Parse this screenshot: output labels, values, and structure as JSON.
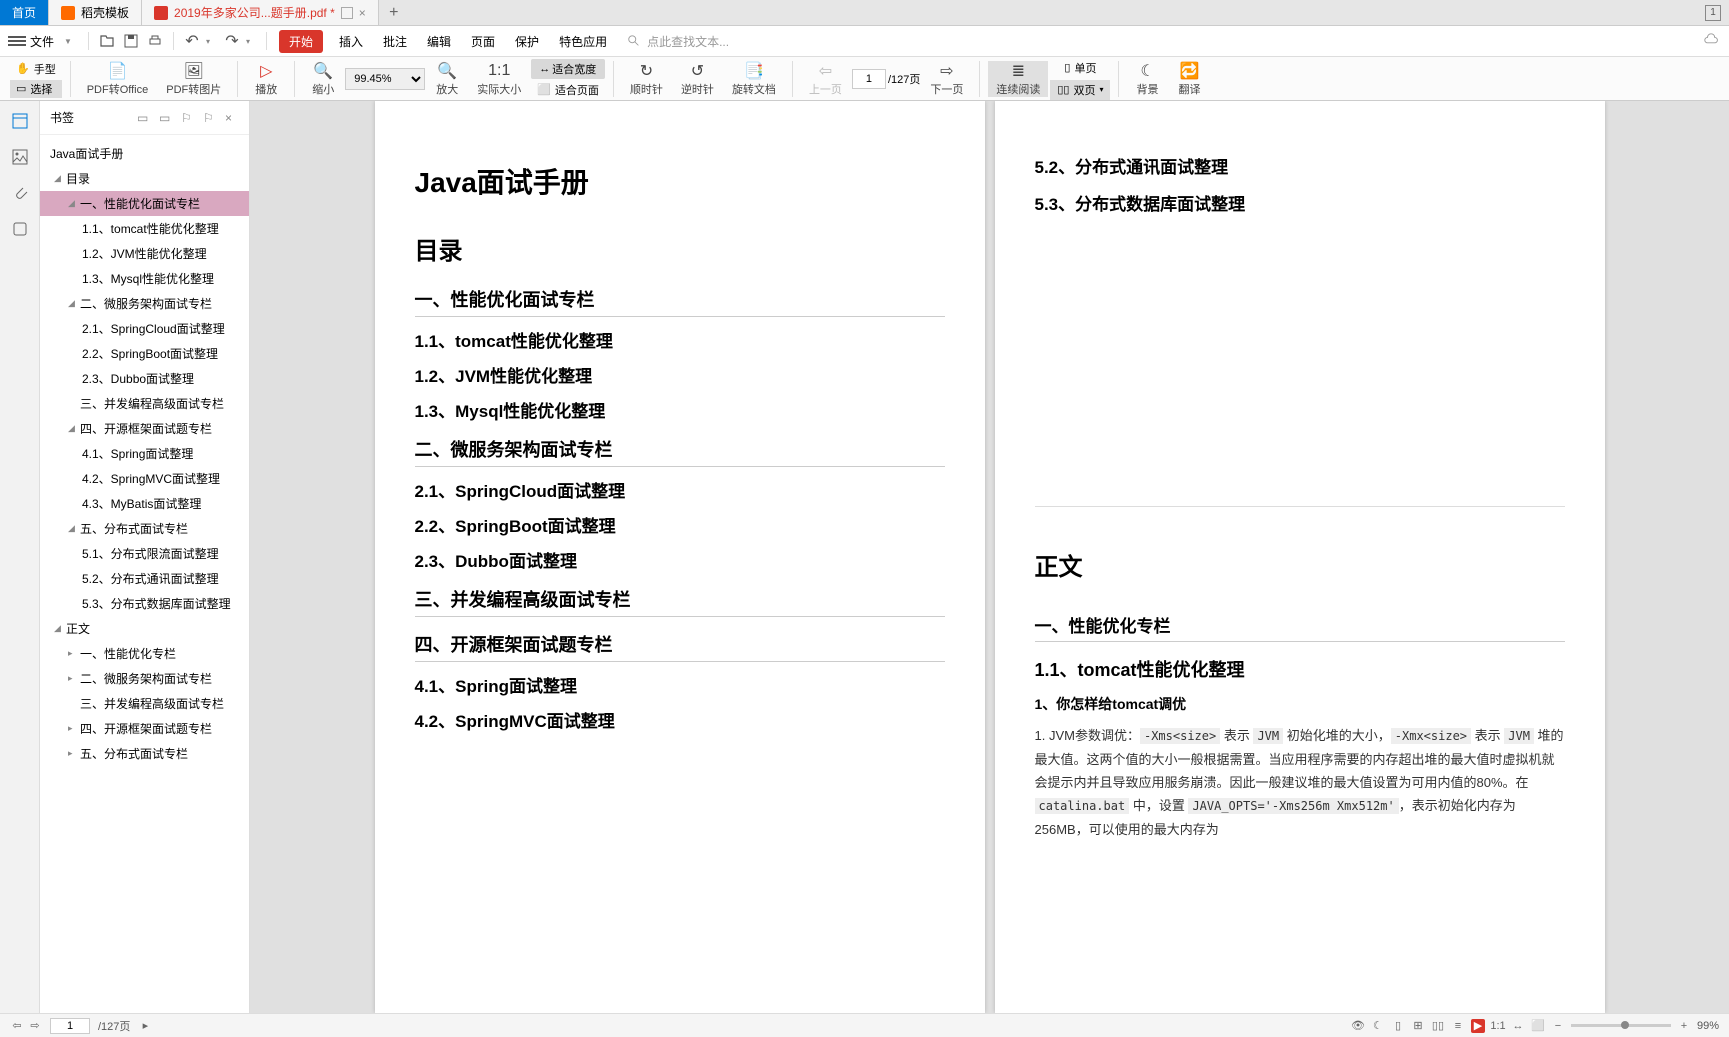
{
  "tabs": {
    "home": "首页",
    "template": "稻壳模板",
    "doc": "2019年多家公司...题手册.pdf *",
    "badge": "1"
  },
  "menubar": {
    "file": "文件",
    "start": "开始",
    "insert": "插入",
    "annotate": "批注",
    "edit": "编辑",
    "page": "页面",
    "protect": "保护",
    "special": "特色应用",
    "search_placeholder": "点此查找文本..."
  },
  "ribbon": {
    "hand": "手型",
    "select": "选择",
    "pdf_office": "PDF转Office",
    "pdf_image": "PDF转图片",
    "play": "播放",
    "zoom_out": "缩小",
    "zoom_value": "99.45%",
    "zoom_in": "放大",
    "actual_size": "实际大小",
    "fit_width": "适合宽度",
    "fit_page": "适合页面",
    "cw": "顺时针",
    "ccw": "逆时针",
    "rotate_doc": "旋转文档",
    "prev_page": "上一页",
    "page_current": "1",
    "page_total": "/127页",
    "next_page": "下一页",
    "continuous": "连续阅读",
    "single_page": "单页",
    "double_page": "双页",
    "background": "背景",
    "translate": "翻译"
  },
  "bookmarks": {
    "title": "书签",
    "root": "Java面试手册",
    "toc": "目录",
    "sec1": "一、性能优化面试专栏",
    "sec1_1": "1.1、tomcat性能优化整理",
    "sec1_2": "1.2、JVM性能优化整理",
    "sec1_3": "1.3、Mysql性能优化整理",
    "sec2": "二、微服务架构面试专栏",
    "sec2_1": "2.1、SpringCloud面试整理",
    "sec2_2": "2.2、SpringBoot面试整理",
    "sec2_3": "2.3、Dubbo面试整理",
    "sec3": "三、并发编程高级面试专栏",
    "sec4": "四、开源框架面试题专栏",
    "sec4_1": "4.1、Spring面试整理",
    "sec4_2": "4.2、SpringMVC面试整理",
    "sec4_3": "4.3、MyBatis面试整理",
    "sec5": "五、分布式面试专栏",
    "sec5_1": "5.1、分布式限流面试整理",
    "sec5_2": "5.2、分布式通讯面试整理",
    "sec5_3": "5.3、分布式数据库面试整理",
    "body": "正文",
    "b1": "一、性能优化专栏",
    "b2": "二、微服务架构面试专栏",
    "b3": "三、并发编程高级面试专栏",
    "b4": "四、开源框架面试题专栏",
    "b5": "五、分布式面试专栏"
  },
  "doc_page1": {
    "title": "Java面试手册",
    "toc": "目录",
    "h1": "一、性能优化面试专栏",
    "h1_1": "1.1、tomcat性能优化整理",
    "h1_2": "1.2、JVM性能优化整理",
    "h1_3": "1.3、Mysql性能优化整理",
    "h2": "二、微服务架构面试专栏",
    "h2_1": "2.1、SpringCloud面试整理",
    "h2_2": "2.2、SpringBoot面试整理",
    "h2_3": "2.3、Dubbo面试整理",
    "h3": "三、并发编程高级面试专栏",
    "h4": "四、开源框架面试题专栏",
    "h4_1": "4.1、Spring面试整理",
    "h4_2": "4.2、SpringMVC面试整理"
  },
  "doc_page2": {
    "r5_2": "5.2、分布式通讯面试整理",
    "r5_3": "5.3、分布式数据库面试整理",
    "body_title": "正文",
    "rh1": "一、性能优化专栏",
    "rh1_1": "1.1、tomcat性能优化整理",
    "q1": "1、你怎样给tomcat调优",
    "p1a": "1. JVM参数调优：",
    "c1": "-Xms<size>",
    "p1b": " 表示 ",
    "c2": "JVM",
    "p1c": " 初始化堆的大小，",
    "c3": "-Xmx<size>",
    "p1d": " 表示 ",
    "c4": "JVM",
    "p1e": " 堆的最大值。这两个值的大小一般根据需置。当应用程序需要的内存超出堆的最大值时虚拟机就会提示内并且导致应用服务崩溃。因此一般建议堆的最大值设置为可用内值的80%。在 ",
    "c5": "catalina.bat",
    "p1f": " 中，设置 ",
    "c6": "JAVA_OPTS='-Xms256m Xmx512m'",
    "p1g": "，表示初始化内存为256MB，可以使用的最大内存为"
  },
  "status": {
    "page_current": "1",
    "page_total": "/127页",
    "zoom": "99%"
  }
}
